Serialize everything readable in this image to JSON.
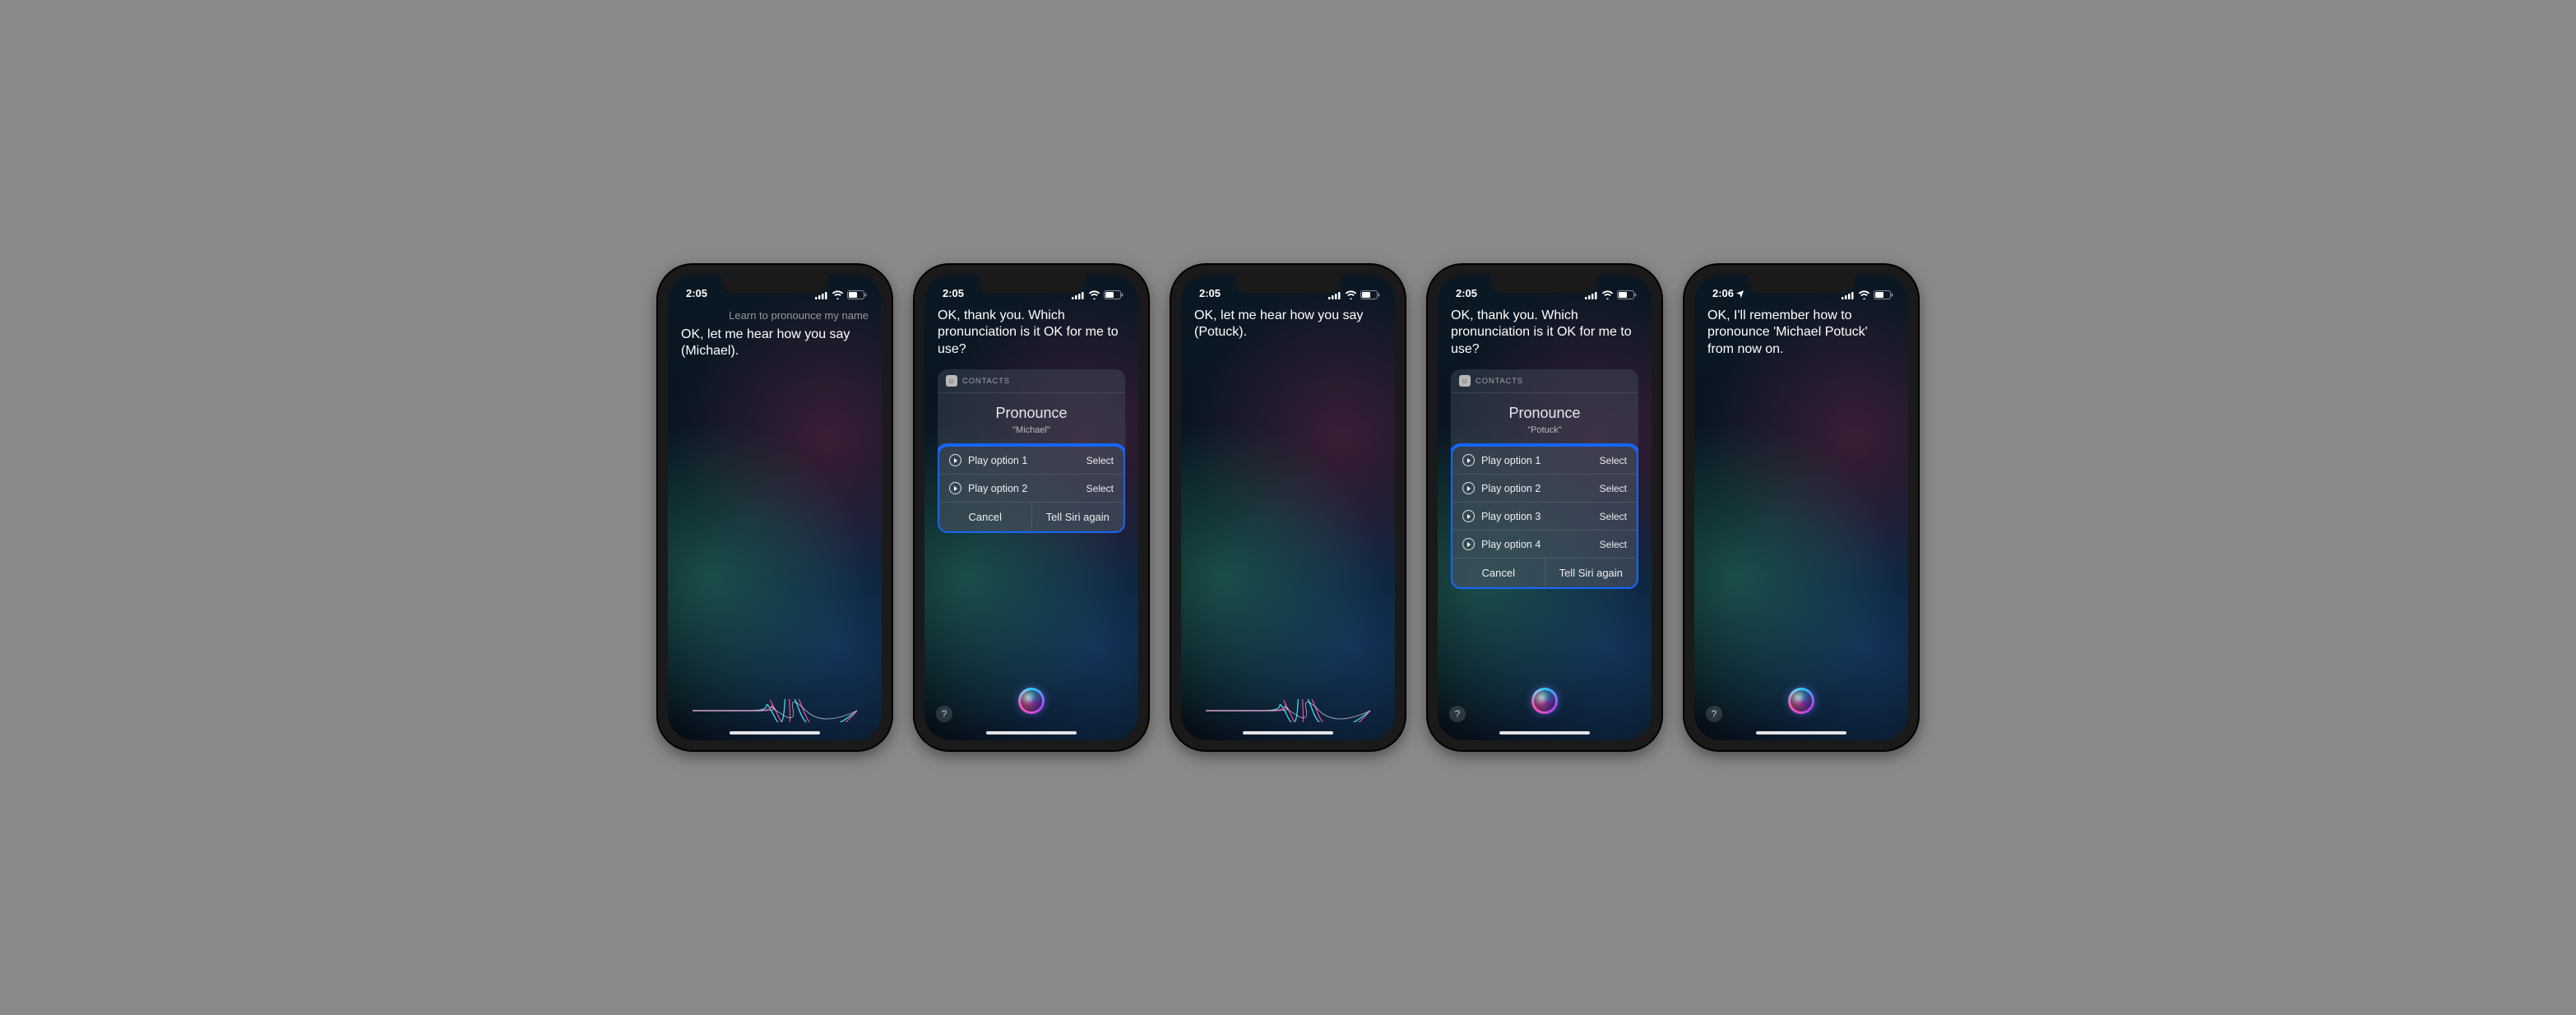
{
  "common": {
    "signal_label": "cellular-signal",
    "wifi_label": "wifi",
    "battery_label": "battery",
    "help_label": "?"
  },
  "screens": [
    {
      "time": "2:05",
      "location_arrow": false,
      "user_prompt": "Learn to pronounce my name",
      "siri_text": "OK, let me hear how you say (Michael).",
      "card": null,
      "bottom_style": "wave",
      "show_help": false
    },
    {
      "time": "2:05",
      "location_arrow": false,
      "user_prompt": null,
      "siri_text": "OK, thank you. Which pronunciation is it OK for me to use?",
      "card": {
        "source": "CONTACTS",
        "title": "Pronounce",
        "subtitle": "\"Michael\"",
        "options": [
          {
            "label": "Play option 1",
            "action": "Select"
          },
          {
            "label": "Play option 2",
            "action": "Select"
          }
        ],
        "buttons": {
          "cancel": "Cancel",
          "retry": "Tell Siri again"
        }
      },
      "bottom_style": "orb",
      "show_help": true
    },
    {
      "time": "2:05",
      "location_arrow": false,
      "user_prompt": null,
      "siri_text": "OK, let me hear how you say (Potuck).",
      "card": null,
      "bottom_style": "wave",
      "show_help": false
    },
    {
      "time": "2:05",
      "location_arrow": false,
      "user_prompt": null,
      "siri_text": "OK, thank you. Which pronunciation is it OK for me to use?",
      "card": {
        "source": "CONTACTS",
        "title": "Pronounce",
        "subtitle": "\"Potuck\"",
        "options": [
          {
            "label": "Play option 1",
            "action": "Select"
          },
          {
            "label": "Play option 2",
            "action": "Select"
          },
          {
            "label": "Play option 3",
            "action": "Select"
          },
          {
            "label": "Play option 4",
            "action": "Select"
          }
        ],
        "buttons": {
          "cancel": "Cancel",
          "retry": "Tell Siri again"
        }
      },
      "bottom_style": "orb",
      "show_help": true
    },
    {
      "time": "2:06",
      "location_arrow": true,
      "user_prompt": null,
      "siri_text": "OK, I'll remember how to pronounce 'Michael Potuck' from now on.",
      "card": null,
      "bottom_style": "orb",
      "show_help": true
    }
  ]
}
